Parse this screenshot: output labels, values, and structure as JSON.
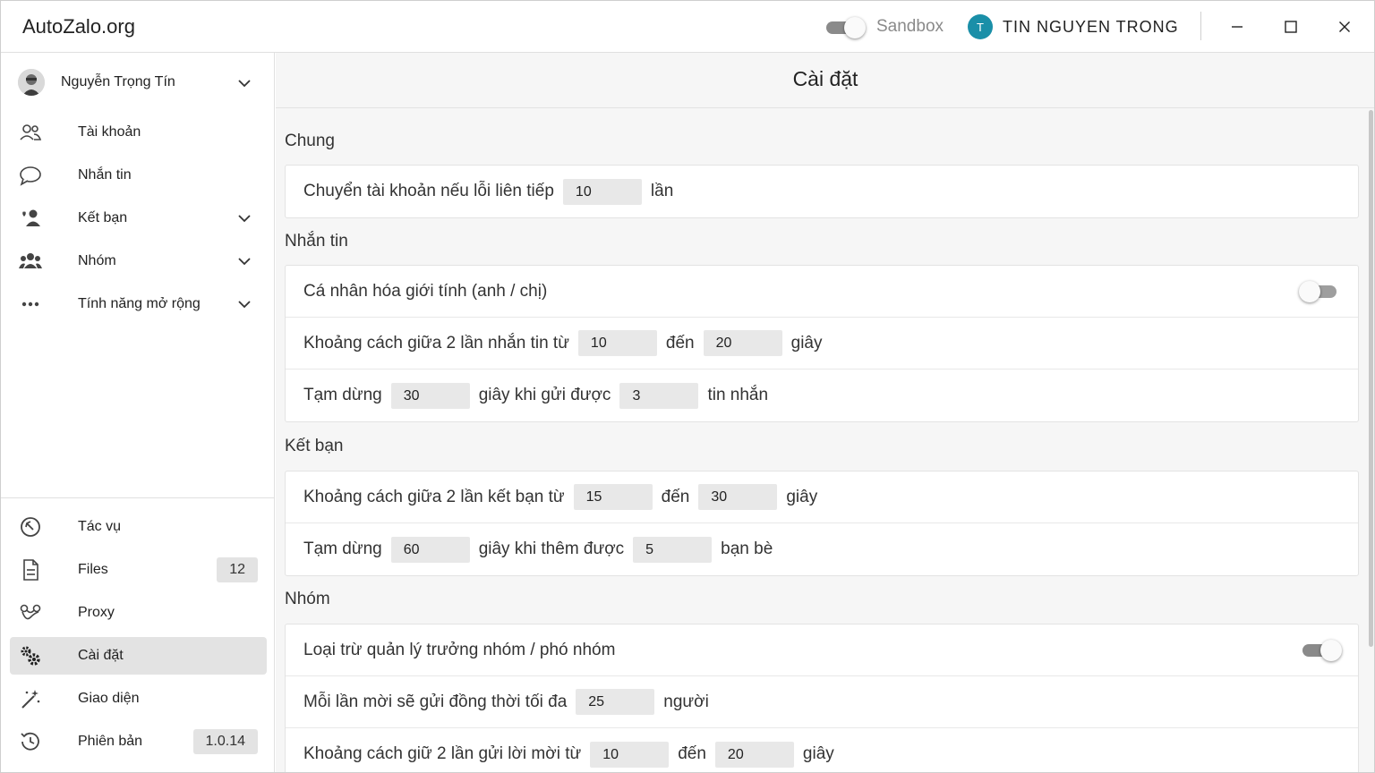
{
  "app": {
    "title": "AutoZalo.org",
    "sandbox_label": "Sandbox",
    "user_initial": "T",
    "user_name": "TIN NGUYEN TRONG"
  },
  "sidebar": {
    "profile_name": "Nguyễn Trọng Tín",
    "top_items": [
      {
        "label": "Tài khoản",
        "icon": "users-icon"
      },
      {
        "label": "Nhắn tin",
        "icon": "chat-bubble-icon"
      },
      {
        "label": "Kết bạn",
        "icon": "add-friend-icon"
      },
      {
        "label": "Nhóm",
        "icon": "group-icon"
      },
      {
        "label": "Tính năng mở rộng",
        "icon": "more-icon"
      }
    ],
    "bottom_items": [
      {
        "label": "Tác vụ",
        "icon": "tasks-icon"
      },
      {
        "label": "Files",
        "icon": "file-icon",
        "badge": "12"
      },
      {
        "label": "Proxy",
        "icon": "proxy-icon"
      },
      {
        "label": "Cài đặt",
        "icon": "gears-icon"
      },
      {
        "label": "Giao diện",
        "icon": "theme-icon"
      },
      {
        "label": "Phiên bản",
        "icon": "history-icon",
        "badge": "1.0.14"
      }
    ]
  },
  "main": {
    "title": "Cài đặt",
    "sections": {
      "chung": {
        "title": "Chung",
        "r1": {
          "a": "Chuyển tài khoản nếu lỗi liên tiếp",
          "v1": "10",
          "b": "lần"
        }
      },
      "nhantin": {
        "title": "Nhắn tin",
        "r1": {
          "a": "Cá nhân hóa giới tính (anh / chị)"
        },
        "r2": {
          "a": "Khoảng cách giữa 2 lần nhắn tin từ",
          "v1": "10",
          "b": "đến",
          "v2": "20",
          "c": "giây"
        },
        "r3": {
          "a": "Tạm dừng",
          "v1": "30",
          "b": "giây khi gửi được",
          "v2": "3",
          "c": "tin nhắn"
        }
      },
      "ketban": {
        "title": "Kết bạn",
        "r1": {
          "a": "Khoảng cách giữa 2 lần kết bạn từ",
          "v1": "15",
          "b": "đến",
          "v2": "30",
          "c": "giây"
        },
        "r2": {
          "a": "Tạm dừng",
          "v1": "60",
          "b": "giây khi thêm được",
          "v2": "5",
          "c": "bạn bè"
        }
      },
      "nhom": {
        "title": "Nhóm",
        "r1": {
          "a": "Loại trừ quản lý trưởng nhóm / phó nhóm"
        },
        "r2": {
          "a": "Mỗi lần mời sẽ gửi đồng thời tối đa",
          "v1": "25",
          "b": "người"
        },
        "r3": {
          "a": "Khoảng cách giữ 2 lần gửi lời mời từ",
          "v1": "10",
          "b": "đến",
          "v2": "20",
          "c": "giây"
        }
      }
    }
  },
  "state": {
    "sandbox_on": true,
    "gender_personalization_on": false,
    "exclude_group_admins_on": true
  }
}
